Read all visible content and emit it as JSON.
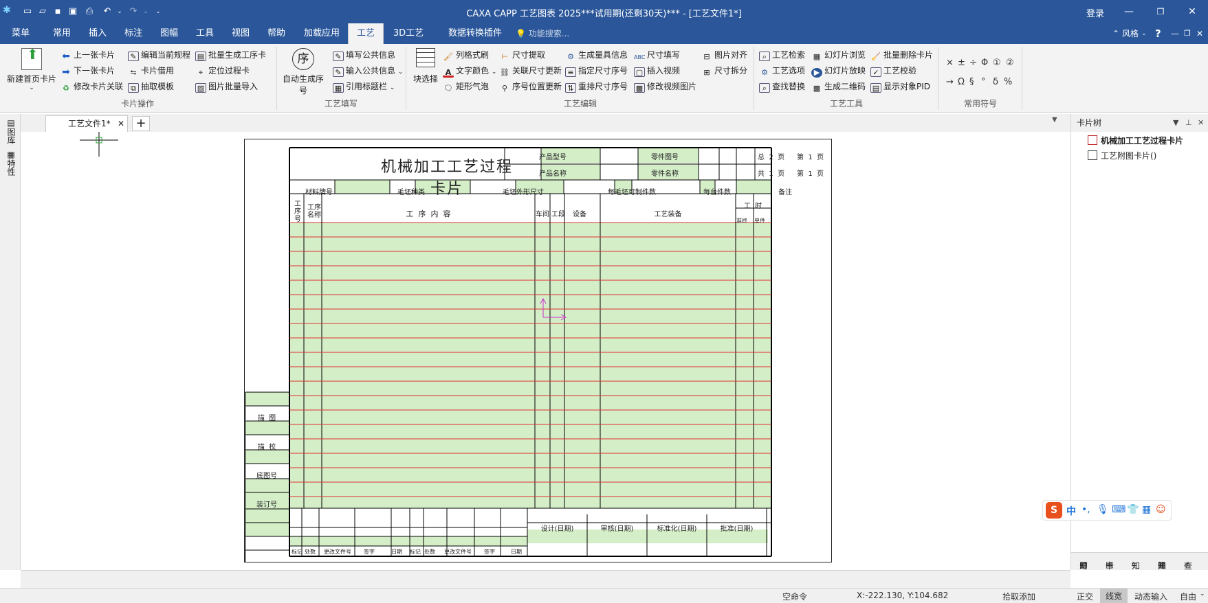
{
  "titlebar": {
    "title": "CAXA CAPP 工艺图表 2025***试用期(还剩30天)*** - [工艺文件1*]",
    "login": "登录"
  },
  "menu": {
    "items": [
      "菜单",
      "常用",
      "插入",
      "标注",
      "图幅",
      "工具",
      "视图",
      "帮助",
      "加载应用",
      "工艺",
      "3D工艺",
      "数据转换插件"
    ],
    "active": "工艺",
    "search_placeholder": "功能搜索...",
    "style_label": "风格"
  },
  "ribbon": {
    "card_ops": {
      "new_first_card": "新建首页卡片",
      "prev_card": "上一张卡片",
      "next_card": "下一张卡片",
      "modify_card_link": "修改卡片关联",
      "edit_current_rule": "编辑当前规程",
      "card_borrow": "卡片借用",
      "extract_template": "抽取模板",
      "batch_gen_process_card": "批量生成工序卡",
      "locate_process": "定位过程卡",
      "image_batch_import": "图片批量导入",
      "group_label": "卡片操作"
    },
    "process_fill": {
      "auto_seq": "自动生成序号",
      "seq_glyph": "序",
      "fill_public": "填写公共信息",
      "input_public": "输入公共信息",
      "ref_title": "引用标题栏",
      "group_label": "工艺填写"
    },
    "process_edit": {
      "block_select": "块选择",
      "column_brush": "列格式刷",
      "text_color": "文字颜色",
      "rect_bubble": "矩形气泡",
      "size_extract": "尺寸提取",
      "link_size_update": "关联尺寸更新",
      "seq_pos_update": "序号位置更新",
      "gen_gauge_info": "生成量具信息",
      "assign_size_seq": "指定尺寸序号",
      "reorder_size_seq": "重排尺寸序号",
      "size_fill": "尺寸填写",
      "insert_video": "插入视频",
      "modify_video_image": "修改视频图片",
      "image_align": "图片对齐",
      "size_split": "尺寸拆分",
      "group_label": "工艺编辑"
    },
    "process_tools": {
      "process_search": "工艺检索",
      "process_options": "工艺选项",
      "find_replace": "查找替换",
      "slide_browse": "幻灯片浏览",
      "slide_play": "幻灯片放映",
      "gen_qrcode": "生成二维码",
      "batch_delete_card": "批量删除卡片",
      "process_check": "工艺校验",
      "show_pid": "显示对象PID",
      "group_label": "工艺工具"
    },
    "symbols": {
      "row1": [
        "×",
        "±",
        "÷",
        "Φ",
        "①",
        "②"
      ],
      "row2": [
        "→",
        "Ω",
        "§",
        "°",
        "δ",
        "%"
      ],
      "group_label": "常用符号"
    }
  },
  "doc_tab": {
    "label": "工艺文件1*"
  },
  "left_panel": {
    "items": [
      "图库",
      "特性"
    ]
  },
  "card": {
    "title": "机械加工工艺过程卡片",
    "product_model": "产品型号",
    "product_name": "产品名称",
    "part_no": "零件图号",
    "part_name": "零件名称",
    "total_pages": {
      "prefix": "总",
      "value": "2",
      "suffix": "页"
    },
    "total_pages2": {
      "prefix": "共",
      "value": "1",
      "suffix": "页"
    },
    "page_no": {
      "prefix": "第",
      "value": "1",
      "suffix": "页"
    },
    "page_no2": {
      "prefix": "第",
      "value": "1",
      "suffix": "页"
    },
    "material_label": "材料牌号",
    "blank_type": "毛坯种类",
    "blank_size": "毛坯外形尺寸",
    "per_blank_count": "每毛坯可制件数",
    "per_unit_count": "每台件数",
    "remark": "备注",
    "col_seq_no": "工序号",
    "col_seq_name": "工序名称",
    "col_content": "工  序  内  容",
    "col_workshop": "车间",
    "col_section": "工段",
    "col_equipment": "设备",
    "col_tooling": "工艺装备",
    "col_hours": "工  时",
    "col_standard": "准终",
    "col_unit": "单件",
    "side_labels": [
      "描  图",
      "描  校",
      "底图号",
      "装订号"
    ],
    "sign_labels": [
      "设计(日期)",
      "审核(日期)",
      "标准化(日期)",
      "批准(日期)"
    ],
    "change_labels": [
      "标记",
      "处数",
      "更改文件号",
      "签字",
      "日期",
      "标记",
      "处数",
      "更改文件号",
      "签字",
      "日期"
    ]
  },
  "card_tree": {
    "header": "卡片树",
    "nodes": [
      "机械加工工艺过程卡片",
      "工艺附图卡片()"
    ],
    "bottom_tabs": [
      "幻",
      "卡",
      "知",
      "知",
      "查"
    ]
  },
  "ime": {
    "label": "中"
  },
  "status": {
    "command": "空命令",
    "coords": "X:-222.130, Y:104.682",
    "pick_add": "拾取添加",
    "ortho": "正交",
    "linewidth": "线宽",
    "dynamic_input": "动态输入",
    "auto": "自由"
  },
  "colors": {
    "title_bg": "#2b579a",
    "grid_red": "#e03030",
    "cell_green": "#d4eec8",
    "cursor_magenta": "#cc33cc"
  }
}
